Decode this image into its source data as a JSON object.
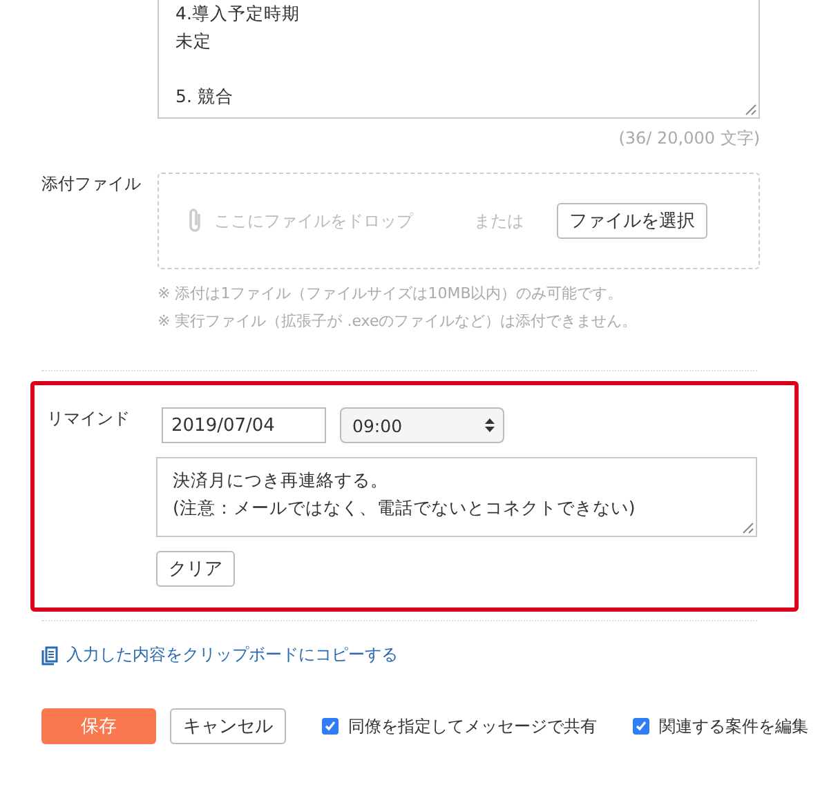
{
  "memo": {
    "paragraphs": [
      [
        "4.導入予定時期",
        "未定"
      ],
      [
        "5. 競合"
      ]
    ],
    "counter": "(36/ 20,000 文字)"
  },
  "attachment": {
    "label": "添付ファイル",
    "drop_text": "ここにファイルをドロップ",
    "or_text": "または",
    "choose_button": "ファイルを選択",
    "notes": [
      "※ 添付は1ファイル（ファイルサイズは10MB以内）のみ可能です。",
      "※ 実行ファイル（拡張子が .exeのファイルなど）は添付できません。"
    ]
  },
  "remind": {
    "label": "リマインド",
    "date": "2019/07/04",
    "time": "09:00",
    "message_lines": [
      "決済月につき再連絡する。",
      "(注意：メールではなく、電話でないとコネクトできない)"
    ],
    "clear_button": "クリア"
  },
  "copy_link": "入力した内容をクリップボードにコピーする",
  "actions": {
    "save": "保存",
    "cancel": "キャンセル"
  },
  "options": [
    {
      "label": "同僚を指定してメッセージで共有",
      "checked": true
    },
    {
      "label": "関連する案件を編集",
      "checked": true
    }
  ]
}
